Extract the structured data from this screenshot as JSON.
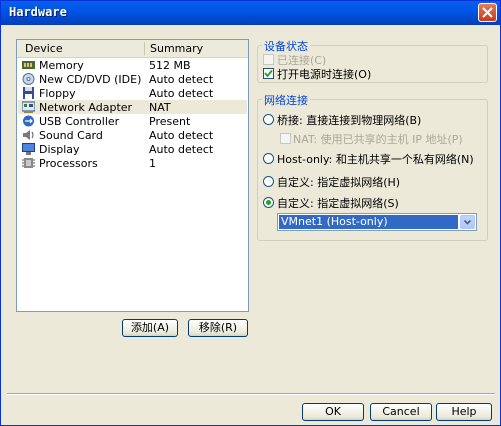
{
  "window": {
    "title": "Hardware"
  },
  "device_list": {
    "headers": {
      "device": "Device",
      "summary": "Summary"
    },
    "devices": [
      {
        "name": "Memory",
        "summary": "512 MB",
        "icon": "memory-icon",
        "selected": false
      },
      {
        "name": "New CD/DVD (IDE)",
        "summary": "Auto detect",
        "icon": "cd-dvd-icon",
        "selected": false
      },
      {
        "name": "Floppy",
        "summary": "Auto detect",
        "icon": "floppy-icon",
        "selected": false
      },
      {
        "name": "Network Adapter",
        "summary": "NAT",
        "icon": "network-adapter-icon",
        "selected": true
      },
      {
        "name": "USB Controller",
        "summary": "Present",
        "icon": "usb-icon",
        "selected": false
      },
      {
        "name": "Sound Card",
        "summary": "Auto detect",
        "icon": "sound-card-icon",
        "selected": false
      },
      {
        "name": "Display",
        "summary": "Auto detect",
        "icon": "display-icon",
        "selected": false
      },
      {
        "name": "Processors",
        "summary": "1",
        "icon": "processor-icon",
        "selected": false
      }
    ]
  },
  "list_buttons": {
    "add": "添加(A)",
    "remove": "移除(R)"
  },
  "device_status": {
    "label": "设备状态",
    "connected": {
      "label": "已连接(C)",
      "checked": false,
      "disabled": true
    },
    "connect_at_power_on": {
      "label": "打开电源时连接(O)",
      "checked": true,
      "disabled": false
    }
  },
  "network_connection": {
    "label": "网络连接",
    "options": {
      "bridged": "桥接: 直接连接到物理网络(B)",
      "nat_sub": "NAT: 使用已共享的主机 IP 地址(P)",
      "host_only": "Host-only: 和主机共享一个私有网络(N)",
      "custom_vmnet": "自定义: 指定虚拟网络(H)",
      "custom_specific": "自定义: 指定虚拟网络(S)"
    },
    "selected_option": "custom_specific",
    "network_select": {
      "value": "VMnet1 (Host-only)"
    }
  },
  "footer_buttons": {
    "ok": "OK",
    "cancel": "Cancel",
    "help": "Help"
  },
  "colors": {
    "title_bar": "#0054e3",
    "accent_label": "#0046d5",
    "selection": "#316ac5",
    "radio_dot": "#22a522"
  }
}
